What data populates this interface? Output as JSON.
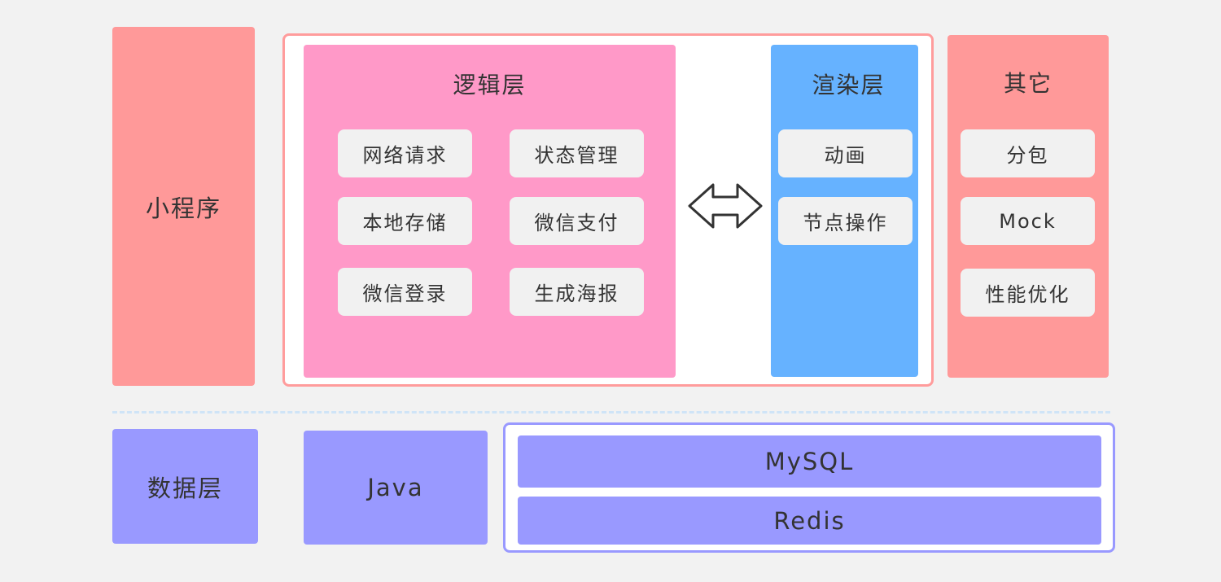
{
  "mini_program": {
    "label": "小程序"
  },
  "logic_layer": {
    "title": "逻辑层",
    "items": [
      "网络请求",
      "状态管理",
      "本地存储",
      "微信支付",
      "微信登录",
      "生成海报"
    ]
  },
  "render_layer": {
    "title": "渲染层",
    "items": [
      "动画",
      "节点操作"
    ]
  },
  "other": {
    "title": "其它",
    "items": [
      "分包",
      "Mock",
      "性能优化"
    ]
  },
  "data_layer": {
    "label": "数据层",
    "backend": "Java",
    "stores": [
      "MySQL",
      "Redis"
    ]
  },
  "colors": {
    "background": "#f2f2f2",
    "mini_program": "#ff9999",
    "logic_layer": "#ff99c8",
    "render_layer": "#66b2ff",
    "data_layer": "#9999ff",
    "chip": "#f1f1f1",
    "divider": "#cfe4f7"
  },
  "icons": {
    "connector": "double-arrow-icon"
  }
}
